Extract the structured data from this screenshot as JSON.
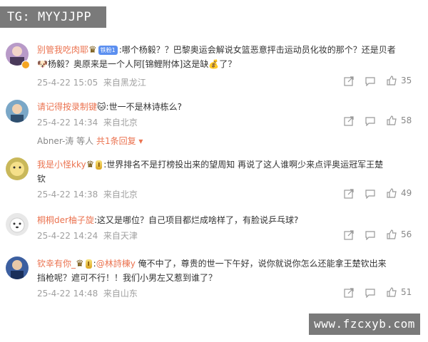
{
  "watermarks": {
    "top_left": "TG: MYYJJPP",
    "bottom_right": "www.fzcxyb.com"
  },
  "comments": [
    {
      "username": "别管我吃肉耶",
      "badges": [
        "铁粉1"
      ],
      "text_line1": ":哪个杨毅？？巴黎奥运会解说女篮恶意抨击运动员化妆的那个？还是贝者",
      "text_line2": "杨毅？奥原来是一个人阿[锦鲤附体]这是缺",
      "text_line2_suffix": "了？",
      "timestamp": "25-4-22 15:05",
      "location": "来自黑龙江",
      "likes": "35",
      "avatar_color": "#b89ac8"
    },
    {
      "username": "请记得按录制键",
      "badges": [],
      "text_line1": ":世一不是林诗栋么?",
      "timestamp": "25-4-22 14:34",
      "location": "来自北京",
      "likes": "58",
      "avatar_color": "#7aa7c7",
      "reply_summary": {
        "user": "Abner-涛",
        "mid": " 等人 ",
        "count": "共1条回复"
      }
    },
    {
      "username": "我是小怪kky",
      "badges": [
        "I"
      ],
      "text_line1": ":世界排名不是打榜投出来的望周知 再说了这人谁啊少来点评奥运冠军王楚",
      "text_line2": "钦",
      "timestamp": "25-4-22 14:38",
      "location": "来自北京",
      "likes": "49",
      "avatar_color": "#c9b85a"
    },
    {
      "username": "桐桐der柚子旋",
      "badges": [],
      "text_line1": ":这又是哪位？自己项目都烂成啥样了，有脸说乒乓球?",
      "timestamp": "25-4-22 14:24",
      "location": "来自天津",
      "likes": "56",
      "avatar_color": "#e8e8e8"
    },
    {
      "username": "钦幸有你_",
      "badges": [
        "I"
      ],
      "mention": "@林詩棟y",
      "text_line1": " 俺不中了，尊贵的世一下午好，说你就说你怎么还能拿王楚钦出来",
      "text_line2": "挡枪呢？遮可不行！！我们小男左又惹到谁了？",
      "timestamp": "25-4-22 14:48",
      "location": "来自山东",
      "likes": "51",
      "avatar_color": "#3c5fa0"
    }
  ],
  "colors": {
    "username": "#eb7350",
    "meta": "#a0a0a0"
  }
}
